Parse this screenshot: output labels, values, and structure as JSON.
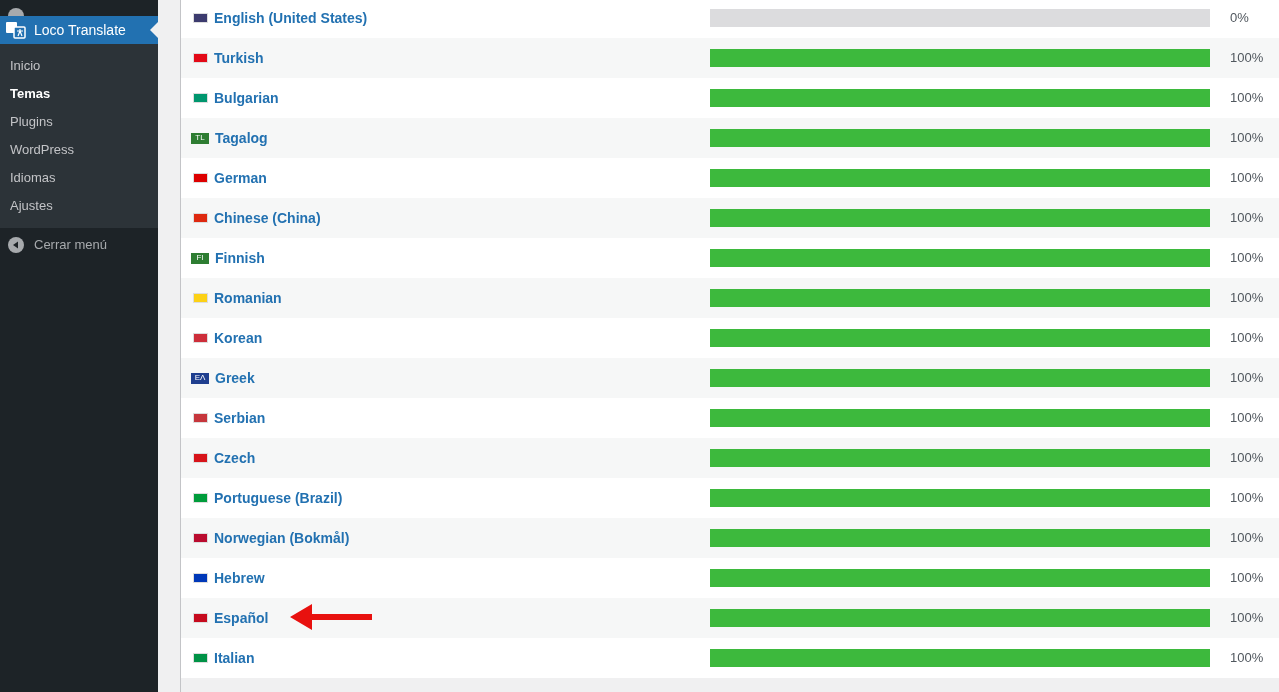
{
  "sidebar": {
    "active_item": {
      "label": "Loco Translate"
    },
    "submenu": [
      {
        "label": "Inicio",
        "selected": false
      },
      {
        "label": "Temas",
        "selected": true
      },
      {
        "label": "Plugins",
        "selected": false
      },
      {
        "label": "WordPress",
        "selected": false
      },
      {
        "label": "Idiomas",
        "selected": false
      },
      {
        "label": "Ajustes",
        "selected": false
      }
    ],
    "collapse": {
      "label": "Cerrar menú"
    }
  },
  "languages": [
    {
      "name": "English (United States)",
      "color": "#3c3b6e",
      "level": 0,
      "reading": "0%",
      "marked": false
    },
    {
      "name": "Turkish",
      "color": "#e30a17",
      "level": 1,
      "reading": "100%",
      "marked": false
    },
    {
      "name": "Bulgarian",
      "color": "#00966e",
      "level": 1,
      "reading": "100%",
      "marked": false
    },
    {
      "name": "Tagalog",
      "color": "#2e7d32",
      "flag_text": "TL",
      "level": 1,
      "reading": "100%",
      "marked": false
    },
    {
      "name": "German",
      "color": "#dd0000",
      "level": 1,
      "reading": "100%",
      "marked": false
    },
    {
      "name": "Chinese (China)",
      "color": "#de2910",
      "level": 1,
      "reading": "100%",
      "marked": false
    },
    {
      "name": "Finnish",
      "color": "#2e7d32",
      "flag_text": "FI",
      "level": 1,
      "reading": "100%",
      "marked": false
    },
    {
      "name": "Romanian",
      "color": "#fcd116",
      "level": 1,
      "reading": "100%",
      "marked": false
    },
    {
      "name": "Korean",
      "color": "#cd2e3a",
      "level": 1,
      "reading": "100%",
      "marked": false
    },
    {
      "name": "Greek",
      "color": "#1f3f8f",
      "flag_text": "ΕΛ",
      "level": 1,
      "reading": "100%",
      "marked": false
    },
    {
      "name": "Serbian",
      "color": "#c6363c",
      "level": 1,
      "reading": "100%",
      "marked": false
    },
    {
      "name": "Czech",
      "color": "#d7141a",
      "level": 1,
      "reading": "100%",
      "marked": false
    },
    {
      "name": "Portuguese (Brazil)",
      "color": "#009c3b",
      "level": 1,
      "reading": "100%",
      "marked": false
    },
    {
      "name": "Norwegian (Bokmål)",
      "color": "#ba0c2f",
      "level": 1,
      "reading": "100%",
      "marked": false
    },
    {
      "name": "Hebrew",
      "color": "#0038b8",
      "level": 1,
      "reading": "100%",
      "marked": false
    },
    {
      "name": "Español",
      "color": "#c60b1e",
      "level": 1,
      "reading": "100%",
      "marked": true
    },
    {
      "name": "Italian",
      "color": "#009246",
      "level": 1,
      "reading": "100%",
      "marked": false
    }
  ]
}
